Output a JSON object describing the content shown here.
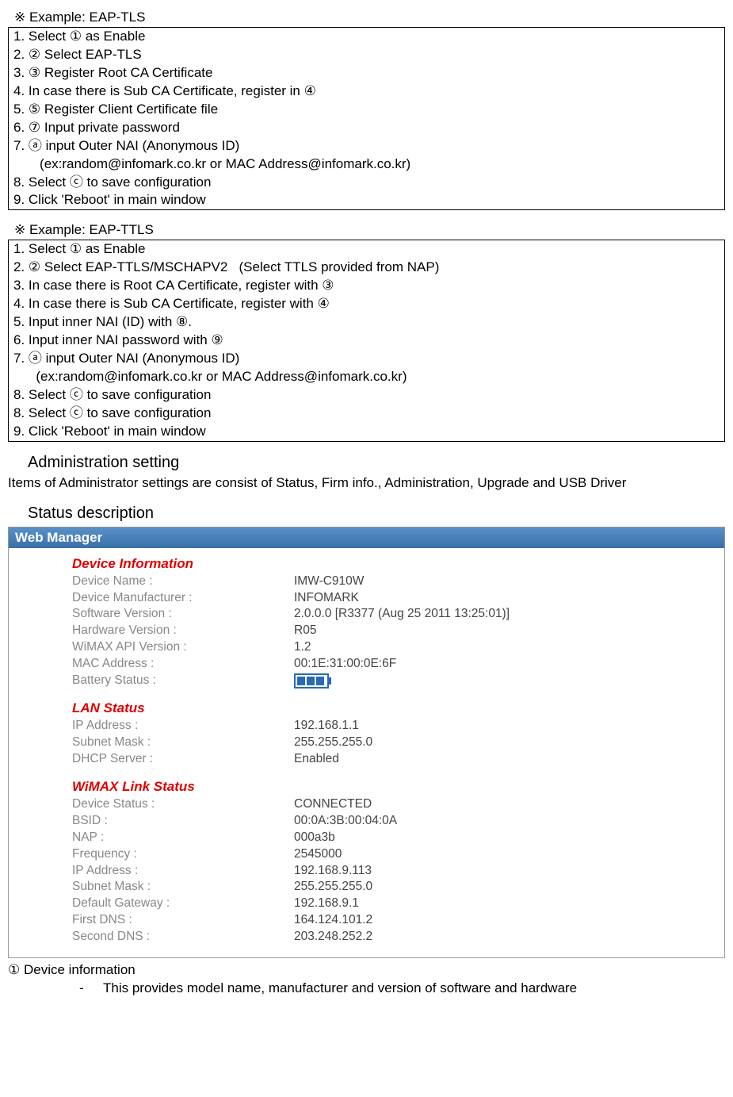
{
  "example1": {
    "header": "※ Example: EAP-TLS",
    "lines": [
      "1. Select ① as Enable",
      "2. ② Select EAP-TLS",
      "3. ③ Register Root CA Certificate",
      "4. In case there is Sub CA Certificate, register in ④",
      "5. ⑤ Register Client Certificate file",
      "6. ⑦ Input private password",
      "7. ⓐ input Outer NAI (Anonymous ID)",
      "       (ex:random@infomark.co.kr or MAC Address@infomark.co.kr)",
      "8. Select ⓒ to save configuration",
      "9. Click 'Reboot' in main window"
    ]
  },
  "example2": {
    "header": "※ Example: EAP-TTLS",
    "lines": [
      "1. Select ① as Enable",
      "2. ② Select EAP-TTLS/MSCHAPV2   (Select TTLS provided from NAP)",
      "3. In case there is Root CA Certificate, register with ③",
      "4. In case there is Sub CA Certificate, register with ④",
      "5. Input inner NAI (ID) with ⑧.",
      "6. Input inner NAI password with ⑨",
      "7. ⓐ input Outer NAI (Anonymous ID)",
      "      (ex:random@infomark.co.kr or MAC Address@infomark.co.kr)",
      "8. Select ⓒ to save configuration",
      "8. Select ⓒ to save configuration",
      "9. Click 'Reboot' in main window"
    ]
  },
  "admin": {
    "title": "Administration setting",
    "text": "Items of Administrator settings are consist of Status, Firm info., Administration, Upgrade and USB Driver"
  },
  "status": {
    "title": "Status description"
  },
  "wm": {
    "header": "Web Manager",
    "g1": {
      "title": "Device Information",
      "rows": [
        {
          "label": "Device Name :",
          "value": "IMW-C910W"
        },
        {
          "label": "Device Manufacturer :",
          "value": "INFOMARK"
        },
        {
          "label": "Software Version :",
          "value": "2.0.0.0 [R3377 (Aug 25 2011 13:25:01)]"
        },
        {
          "label": "Hardware Version :",
          "value": "R05"
        },
        {
          "label": "WiMAX API Version :",
          "value": "1.2"
        },
        {
          "label": "MAC Address :",
          "value": "00:1E:31:00:0E:6F"
        },
        {
          "label": "Battery Status :",
          "value": ""
        }
      ]
    },
    "g2": {
      "title": "LAN Status",
      "rows": [
        {
          "label": "IP Address :",
          "value": "192.168.1.1"
        },
        {
          "label": "Subnet Mask :",
          "value": "255.255.255.0"
        },
        {
          "label": "DHCP Server :",
          "value": "Enabled"
        }
      ]
    },
    "g3": {
      "title": "WiMAX Link Status",
      "rows": [
        {
          "label": "Device Status :",
          "value": "CONNECTED"
        },
        {
          "label": "BSID :",
          "value": "00:0A:3B:00:04:0A"
        },
        {
          "label": "NAP :",
          "value": "000a3b"
        },
        {
          "label": "Frequency :",
          "value": "2545000"
        },
        {
          "label": "IP Address :",
          "value": "192.168.9.113"
        },
        {
          "label": "Subnet Mask :",
          "value": "255.255.255.0"
        },
        {
          "label": "Default Gateway :",
          "value": "192.168.9.1"
        },
        {
          "label": "First DNS :",
          "value": "164.124.101.2"
        },
        {
          "label": "Second DNS :",
          "value": "203.248.252.2"
        }
      ]
    }
  },
  "footer": {
    "line1": "① Device information",
    "bullet": "This provides model name, manufacturer and version of software and hardware"
  }
}
